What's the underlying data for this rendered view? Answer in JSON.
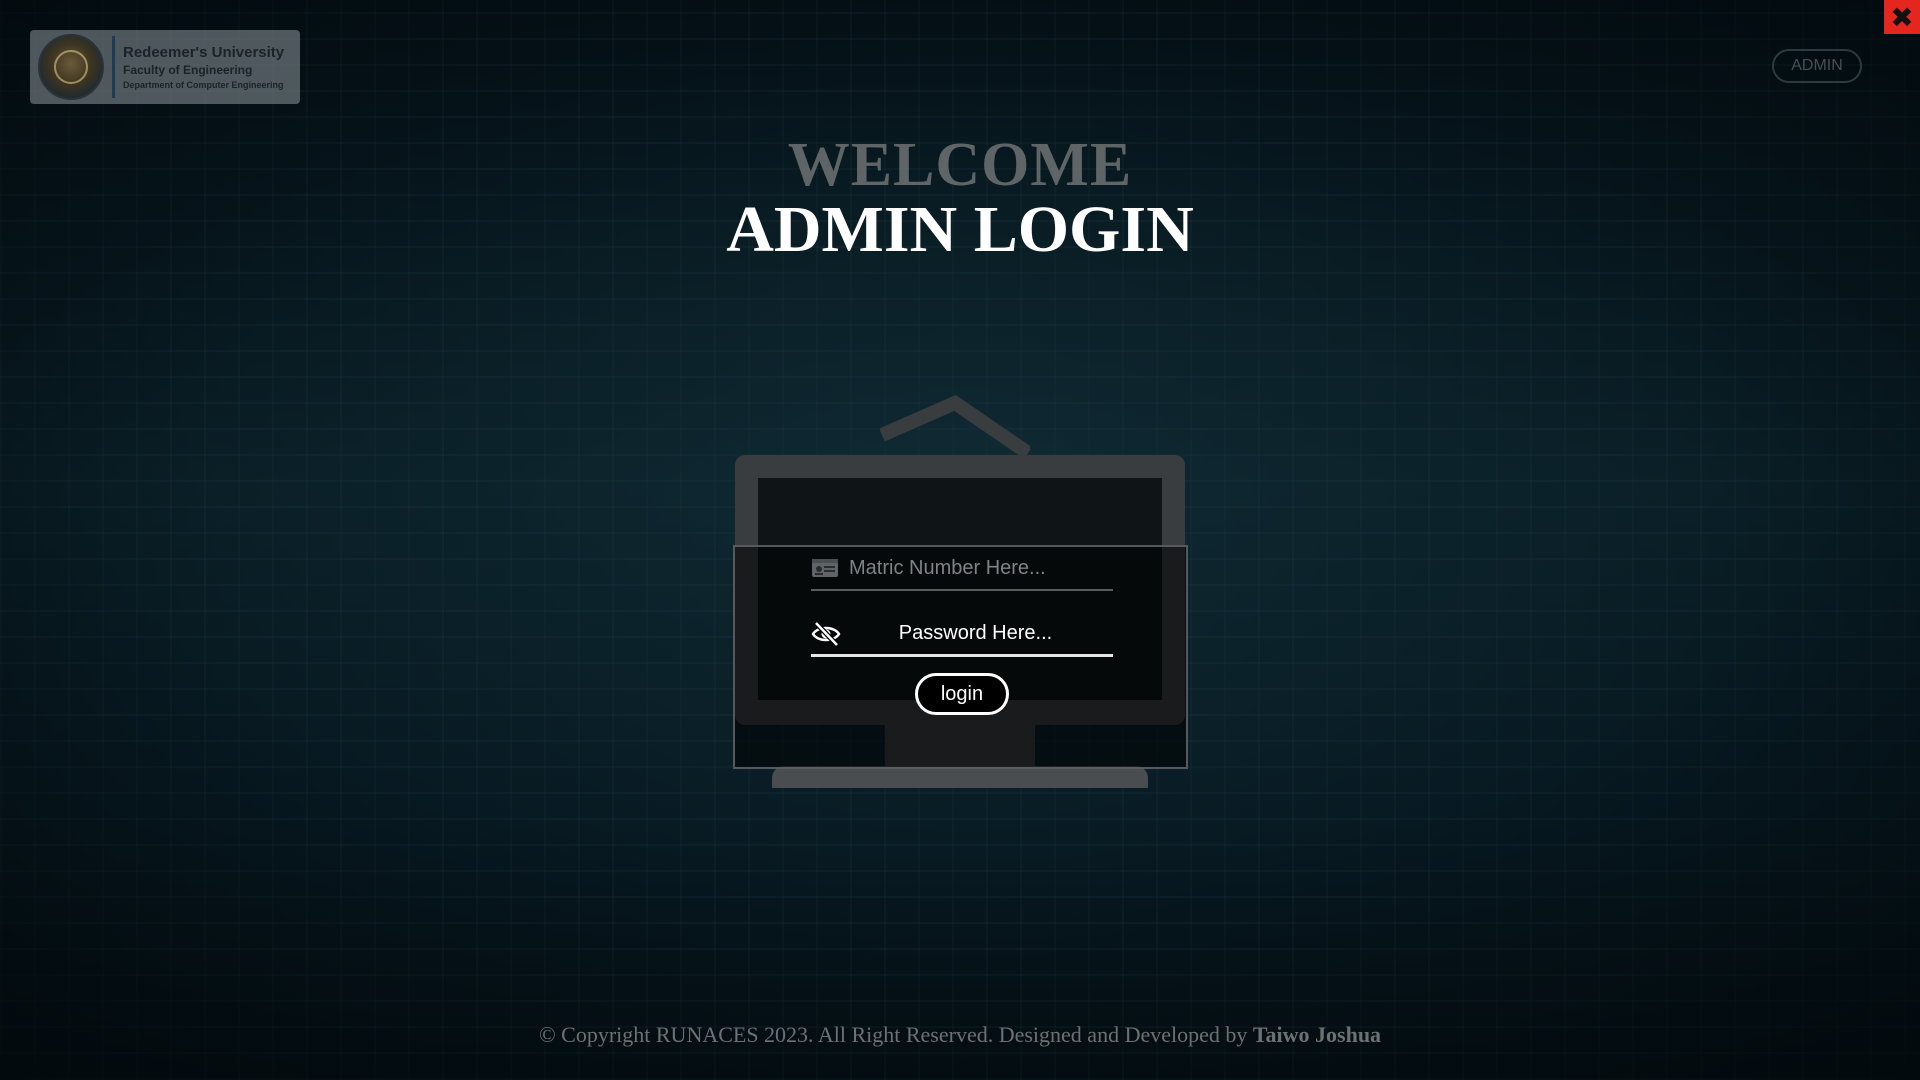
{
  "brand": {
    "university": "Redeemer's University",
    "faculty": "Faculty of Engineering",
    "department": "Department of Computer Engineering"
  },
  "header": {
    "admin_label": "ADMIN",
    "close_icon": "close-x-icon"
  },
  "hero": {
    "welcome": "WELCOME",
    "title": "ADMIN LOGIN"
  },
  "form": {
    "matric_placeholder": "Matric Number Here...",
    "password_placeholder": "Password Here...",
    "matric_icon": "id-card-icon",
    "password_icon": "eye-slash-icon",
    "login_label": "login"
  },
  "footer": {
    "copyright": "© Copyright RUNACES 2023. All Right Reserved. Designed and Developed by",
    "author": "Taiwo Joshua"
  },
  "colors": {
    "close_button": "#e5261f",
    "title": "#ffffff",
    "welcome": "#6e7373"
  }
}
